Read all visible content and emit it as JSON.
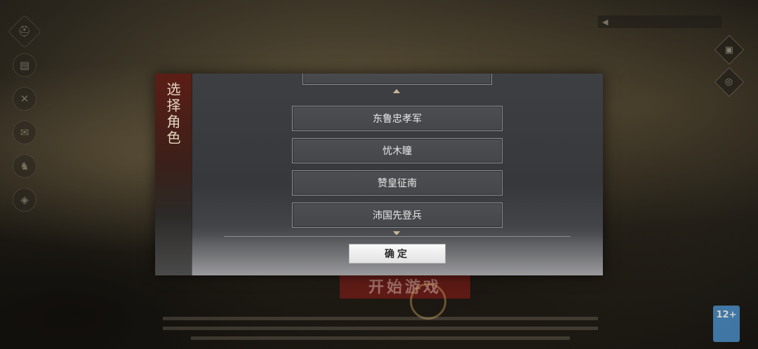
{
  "dialog": {
    "title": "选择角色",
    "roles": [
      "东鲁忠孝军",
      "忧木瞳",
      "赞皇征南",
      "沛国先登兵"
    ],
    "confirm_label": "确定"
  },
  "background": {
    "start_label": "开始游戏",
    "age_rating": "12+"
  },
  "icons": {
    "side": [
      "helmet-icon",
      "scroll-icon",
      "tools-icon",
      "mail-icon",
      "warrior-icon",
      "shield-icon"
    ],
    "top_right": [
      "announcement-icon",
      "settings-icon"
    ]
  },
  "colors": {
    "dialog_bg": "#3d3f43",
    "sidebar_accent": "#5b1e16",
    "title_text": "#e3d6c0",
    "confirm_bg": "#fafafa"
  }
}
